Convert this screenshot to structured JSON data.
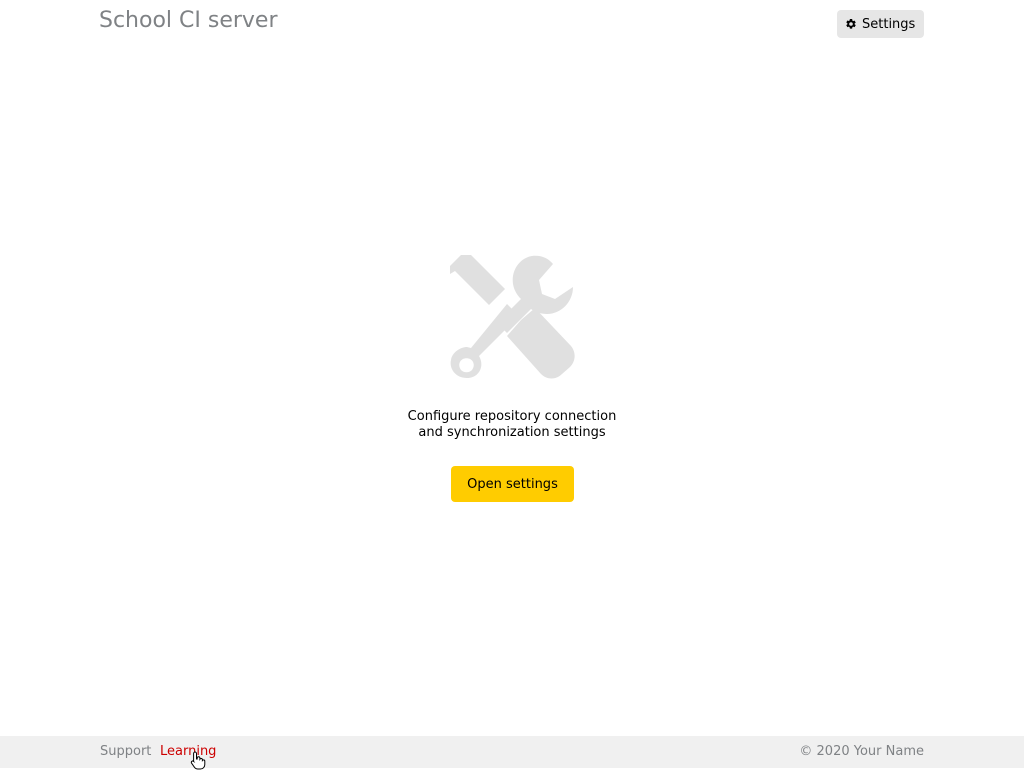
{
  "header": {
    "title": "School CI server",
    "settings_button": {
      "label": "Settings",
      "icon": "gear-icon"
    }
  },
  "main": {
    "illustration_icon": "tools-icon",
    "message_line1": "Configure repository connection",
    "message_line2": "and synchronization settings",
    "open_settings_label": "Open settings"
  },
  "footer": {
    "links": [
      "Support",
      "Learning"
    ],
    "copyright": "© 2020 Your Name"
  },
  "colors": {
    "accent": "#ffcc00",
    "title": "#7f8285",
    "link_active": "#cc0000",
    "footer_bg": "#f0f0f0",
    "illustration": "#e0e0e0"
  }
}
